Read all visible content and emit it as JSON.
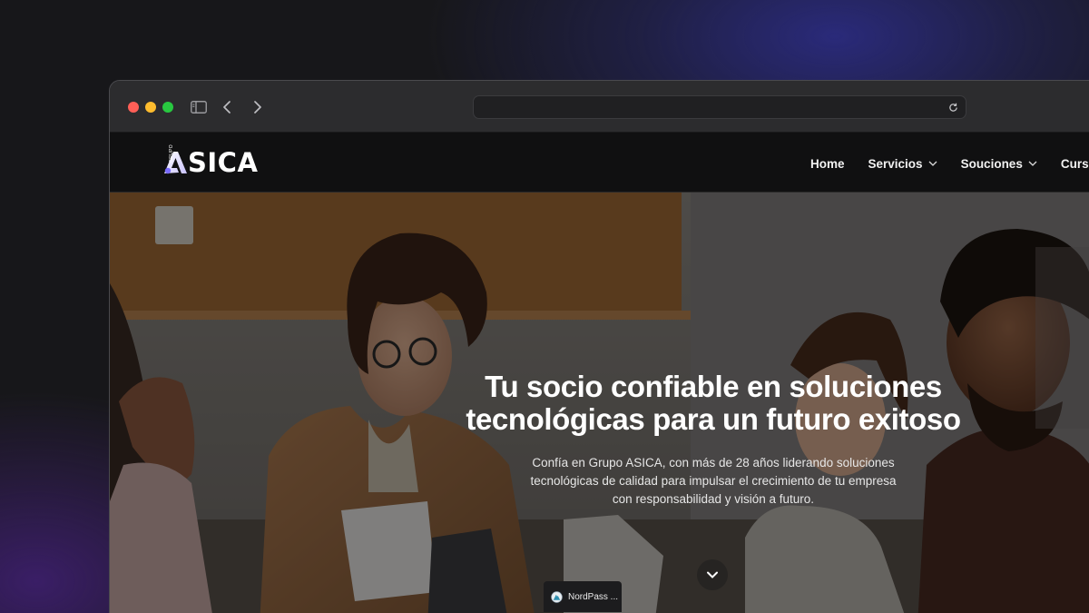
{
  "browser": {
    "url": "",
    "icons": [
      "sidebar-toggle-icon",
      "back-arrow-icon",
      "forward-arrow-icon",
      "reload-icon"
    ]
  },
  "site": {
    "logo": {
      "small_text": "GRUPO",
      "text": "SICA"
    },
    "nav": [
      {
        "label": "Home",
        "dropdown": false
      },
      {
        "label": "Servicios",
        "dropdown": true
      },
      {
        "label": "Souciones",
        "dropdown": true
      },
      {
        "label": "Cursos",
        "dropdown": false
      }
    ]
  },
  "hero": {
    "title_line1": "Tu socio confiable en soluciones",
    "title_line2": "tecnológicas para un futuro exitoso",
    "subtitle_line1": "Confía en Grupo ASICA, con más de 28 años liderando soluciones",
    "subtitle_line2": "tecnológicas de calidad para impulsar el crecimiento de tu empresa",
    "subtitle_line3": "con responsabilidad y visión a futuro."
  },
  "extension_popup": {
    "label": "NordPass ..."
  },
  "colors": {
    "nav_bg": "#101011",
    "accent_logo": "#ffffff",
    "traffic_red": "#ff5f57",
    "traffic_yellow": "#febc2e",
    "traffic_green": "#28c840"
  }
}
